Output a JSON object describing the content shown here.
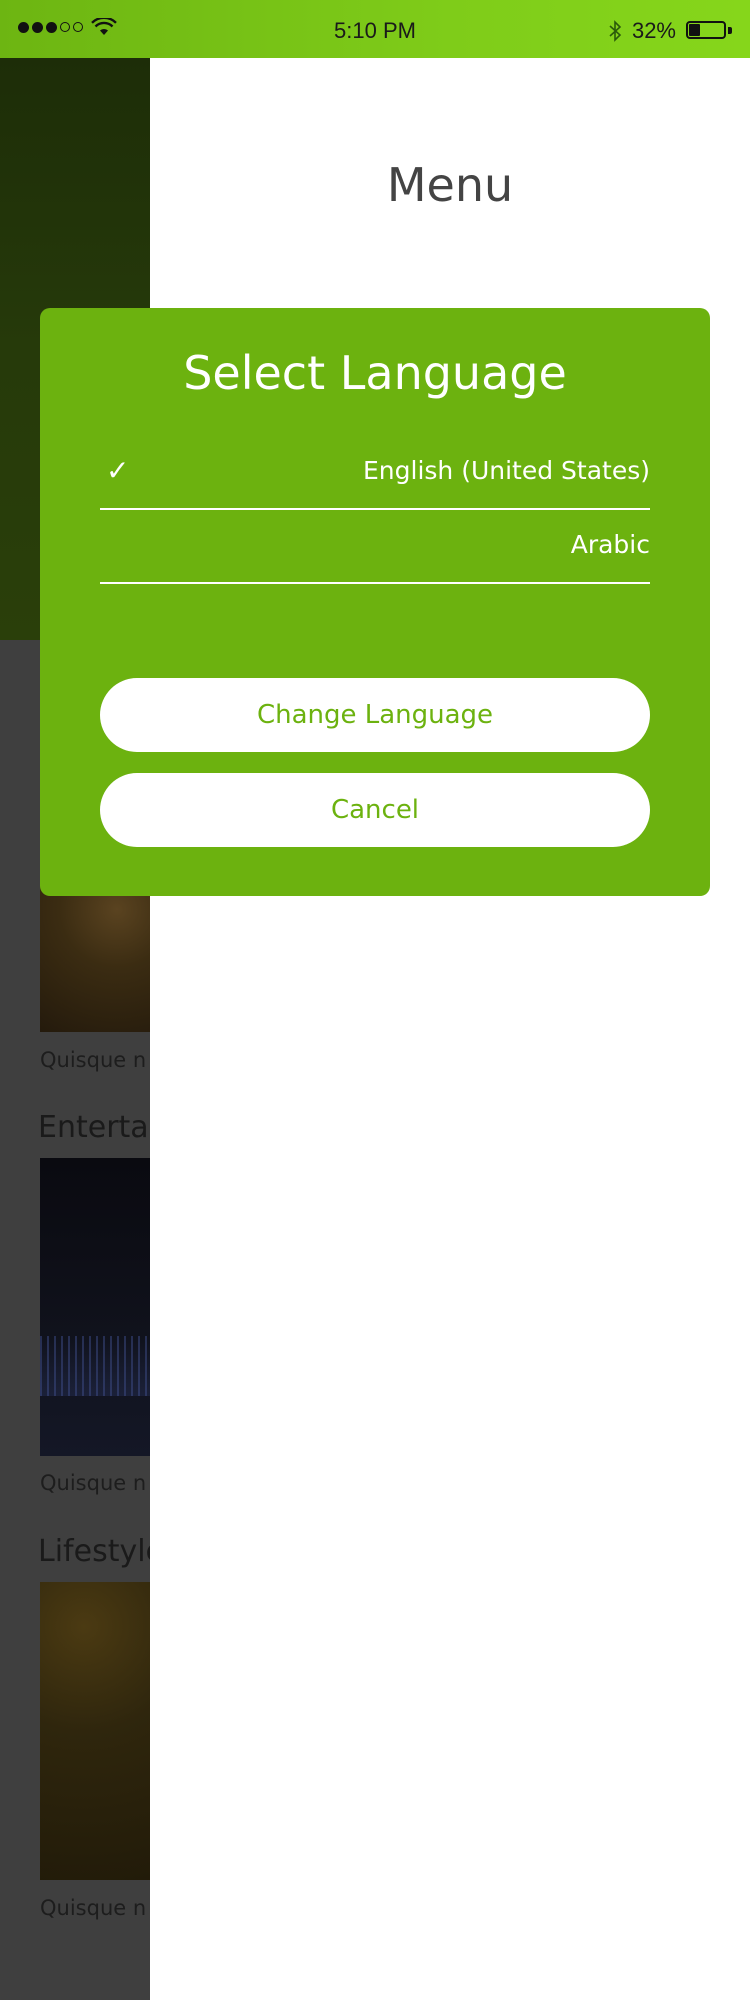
{
  "status_bar": {
    "time": "5:10 PM",
    "battery_text": "32%",
    "battery_level": 0.32,
    "icons": [
      "signal-icon",
      "wifi-icon",
      "bluetooth-icon",
      "battery-icon"
    ]
  },
  "background": {
    "captions": [
      "Quisque n",
      "Quisque n",
      "Quisque n"
    ],
    "sections": [
      "Entertai",
      "Lifestyle"
    ]
  },
  "drawer": {
    "title": "Menu"
  },
  "language_dialog": {
    "title": "Select Language",
    "options": [
      {
        "label": "English (United States)",
        "selected": true
      },
      {
        "label": "Arabic",
        "selected": false
      }
    ],
    "check_glyph": "✓",
    "change_button": "Change Language",
    "cancel_button": "Cancel"
  },
  "colors": {
    "accent": "#6cb20f",
    "status_bar": "#7fcc19",
    "drawer_bg": "#ffffff"
  }
}
